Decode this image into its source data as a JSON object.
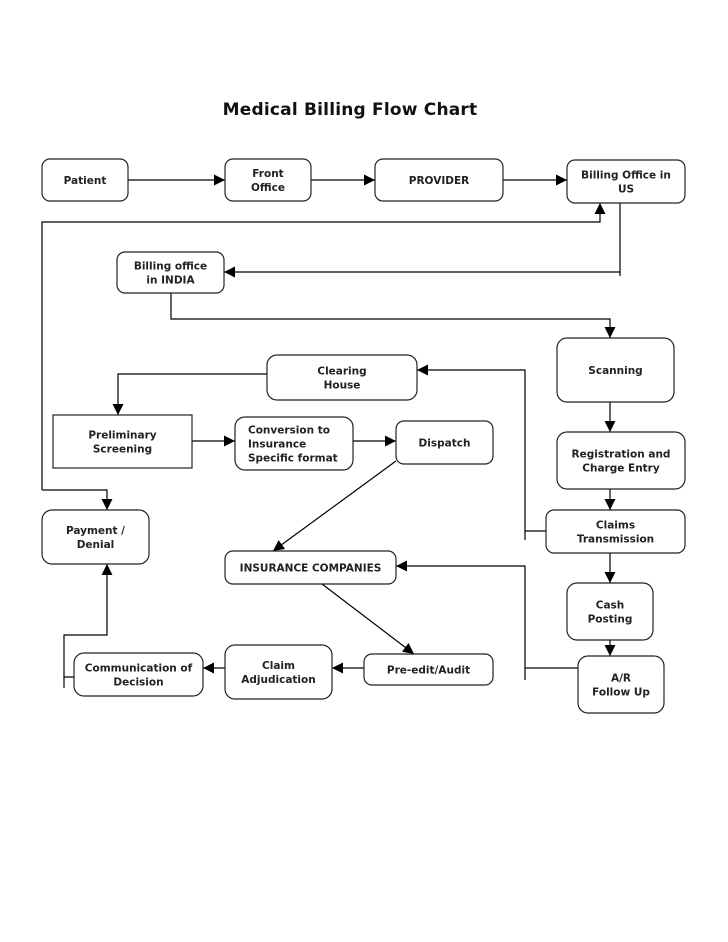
{
  "title": "Medical Billing Flow Chart",
  "nodes": {
    "patient": {
      "lines": [
        "Patient"
      ]
    },
    "front_office": {
      "lines": [
        "Front",
        "Office"
      ]
    },
    "provider": {
      "lines": [
        "PROVIDER"
      ]
    },
    "billing_us": {
      "lines": [
        "Billing Office in",
        "US"
      ]
    },
    "billing_india": {
      "lines": [
        "Billing office",
        "in INDIA"
      ]
    },
    "scanning": {
      "lines": [
        "Scanning"
      ]
    },
    "clearing_house": {
      "lines": [
        "Clearing",
        "House"
      ]
    },
    "preliminary_screening": {
      "lines": [
        "Preliminary",
        "Screening"
      ]
    },
    "conversion": {
      "lines": [
        "Conversion to",
        "Insurance",
        "Specific format"
      ]
    },
    "dispatch": {
      "lines": [
        "Dispatch"
      ]
    },
    "registration": {
      "lines": [
        "Registration and",
        "Charge Entry"
      ]
    },
    "claims_transmission": {
      "lines": [
        "Claims",
        "Transmission"
      ]
    },
    "payment_denial": {
      "lines": [
        "Payment /",
        "Denial"
      ]
    },
    "insurance_companies": {
      "lines": [
        "INSURANCE COMPANIES"
      ]
    },
    "cash_posting": {
      "lines": [
        "Cash",
        "Posting"
      ]
    },
    "communication": {
      "lines": [
        "Communication of",
        "Decision"
      ]
    },
    "claim_adjudication": {
      "lines": [
        "Claim",
        "Adjudication"
      ]
    },
    "pre_edit": {
      "lines": [
        "Pre-edit/Audit"
      ]
    },
    "ar_follow_up": {
      "lines": [
        "A/R",
        "Follow Up"
      ]
    }
  },
  "edges": [
    {
      "from": "Patient",
      "to": "Front Office"
    },
    {
      "from": "Front Office",
      "to": "PROVIDER"
    },
    {
      "from": "PROVIDER",
      "to": "Billing Office in US"
    },
    {
      "from": "Billing Office in US",
      "to": "Billing office in INDIA"
    },
    {
      "from": "Billing office in INDIA",
      "to": "Scanning"
    },
    {
      "from": "Scanning",
      "to": "Registration and Charge Entry"
    },
    {
      "from": "Registration and Charge Entry",
      "to": "Claims Transmission"
    },
    {
      "from": "Claims Transmission",
      "to": "Clearing House"
    },
    {
      "from": "Clearing House",
      "to": "Preliminary Screening"
    },
    {
      "from": "Preliminary Screening",
      "to": "Conversion to Insurance Specific format"
    },
    {
      "from": "Conversion to Insurance Specific format",
      "to": "Dispatch"
    },
    {
      "from": "Dispatch",
      "to": "INSURANCE COMPANIES"
    },
    {
      "from": "INSURANCE COMPANIES",
      "to": "Pre-edit/Audit"
    },
    {
      "from": "Pre-edit/Audit",
      "to": "Claim Adjudication"
    },
    {
      "from": "Claim Adjudication",
      "to": "Communication of Decision"
    },
    {
      "from": "Communication of Decision",
      "to": "Payment / Denial"
    },
    {
      "from": "Claims Transmission",
      "to": "Cash Posting"
    },
    {
      "from": "Cash Posting",
      "to": "A/R Follow Up"
    },
    {
      "from": "A/R Follow Up",
      "to": "INSURANCE COMPANIES"
    },
    {
      "from": "Billing office in INDIA",
      "to": "Billing Office in US"
    },
    {
      "from": "Billing office in INDIA",
      "to": "Payment / Denial"
    }
  ]
}
